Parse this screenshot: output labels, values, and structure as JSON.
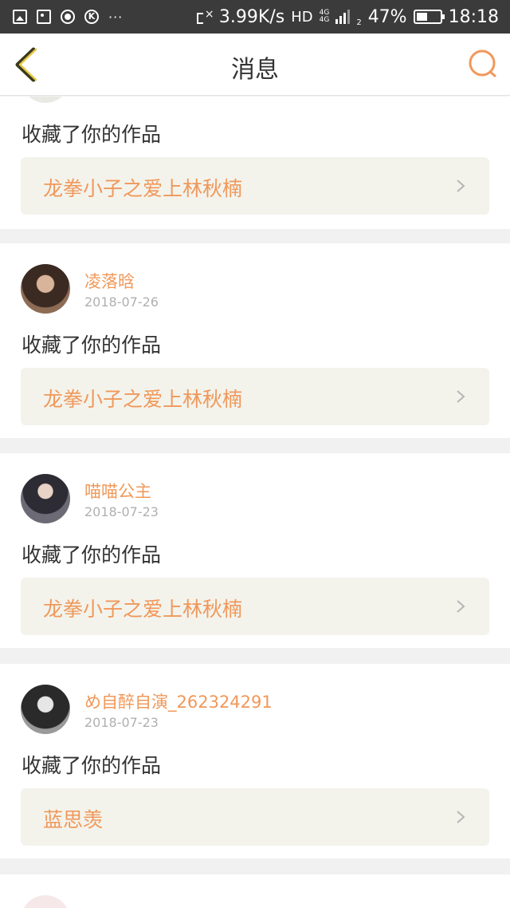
{
  "status_bar": {
    "dots": "···",
    "speed": "3.99K/s",
    "hd": "HD",
    "net_top": "4G",
    "net_bottom": "4G",
    "sim_index": "2",
    "battery": "47%",
    "battery_level": 0.47,
    "time": "18:18"
  },
  "nav": {
    "title": "消息",
    "accent_color": "#f0985a",
    "back_icon": "back-chevron-icon",
    "search_icon": "search-icon"
  },
  "feed": [
    {
      "user": "",
      "date": "",
      "action": "收藏了你的作品",
      "work": "龙拳小子之爱上林秋楠"
    },
    {
      "user": "凌落晗",
      "date": "2018-07-26",
      "action": "收藏了你的作品",
      "work": "龙拳小子之爱上林秋楠"
    },
    {
      "user": "喵喵公主",
      "date": "2018-07-23",
      "action": "收藏了你的作品",
      "work": "龙拳小子之爱上林秋楠"
    },
    {
      "user": "め自醉自演_262324291",
      "date": "2018-07-23",
      "action": "收藏了你的作品",
      "work": "蓝思羡"
    }
  ]
}
